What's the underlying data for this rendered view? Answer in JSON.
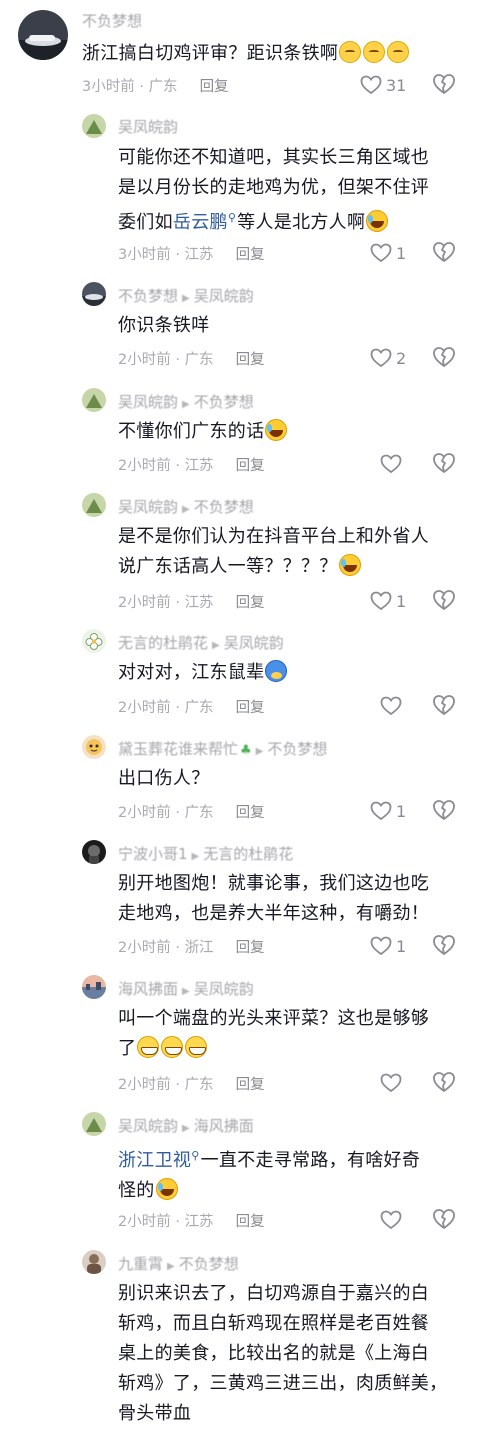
{
  "comments": [
    {
      "user": "不负梦想",
      "text_pre": "浙江搞白切鸡评审？距识条铁啊",
      "time": "3小时前",
      "location": "广东",
      "reply_label": "回复",
      "likes": "31"
    },
    {
      "user": "吴凤皖韵",
      "line1": "可能你还不知道吧，其实长三角区域也",
      "line2": "是以月份长的走地鸡为优，但架不住评",
      "line3_pre": "委们如",
      "topic": "岳云鹏",
      "line3_post": "等人是北方人啊",
      "time": "3小时前",
      "location": "江苏",
      "reply_label": "回复",
      "likes": "1"
    },
    {
      "user": "不负梦想",
      "reply_to": "吴凤皖韵",
      "text": "你识条铁咩",
      "time": "2小时前",
      "location": "广东",
      "reply_label": "回复",
      "likes": "2"
    },
    {
      "user": "吴凤皖韵",
      "reply_to": "不负梦想",
      "text": "不懂你们广东的话",
      "time": "2小时前",
      "location": "江苏",
      "reply_label": "回复",
      "likes": ""
    },
    {
      "user": "吴凤皖韵",
      "reply_to": "不负梦想",
      "line1": "是不是你们认为在抖音平台上和外省人",
      "line2": "说广东话高人一等？？？？",
      "time": "2小时前",
      "location": "江苏",
      "reply_label": "回复",
      "likes": "1"
    },
    {
      "user": "无言的杜鹃花",
      "reply_to": "吴凤皖韵",
      "text": "对对对，江东鼠辈",
      "time": "2小时前",
      "location": "广东",
      "reply_label": "回复",
      "likes": ""
    },
    {
      "user": "黛玉葬花谁来帮忙",
      "reply_to": "不负梦想",
      "text": "出口伤人？",
      "time": "2小时前",
      "location": "广东",
      "reply_label": "回复",
      "likes": "1"
    },
    {
      "user": "宁波小哥1",
      "reply_to": "无言的杜鹃花",
      "line1": "别开地图炮！就事论事，我们这边也吃",
      "line2": "走地鸡，也是养大半年这种，有嚼劲！",
      "time": "2小时前",
      "location": "浙江",
      "reply_label": "回复",
      "likes": "1"
    },
    {
      "user": "海风拂面",
      "reply_to": "吴凤皖韵",
      "line1": "叫一个端盘的光头来评菜？这也是够够",
      "line2": "了",
      "time": "2小时前",
      "location": "广东",
      "reply_label": "回复",
      "likes": ""
    },
    {
      "user": "吴凤皖韵",
      "reply_to": "海风拂面",
      "topic": "浙江卫视",
      "line1_post": "一直不走寻常路，有啥好奇",
      "line2": "怪的",
      "time": "2小时前",
      "location": "江苏",
      "reply_label": "回复",
      "likes": ""
    },
    {
      "user": "九重霄",
      "reply_to": "不负梦想",
      "line1": "别识来识去了，白切鸡源自于嘉兴的白",
      "line2": "斩鸡，而且白斩鸡现在照样是老百姓餐",
      "line3": "桌上的美食，比较出名的就是《上海白",
      "line4": "斩鸡》了，三黄鸡三进三出，肉质鲜美，",
      "line5": "骨头带血"
    }
  ],
  "colors": {
    "text": "#161823",
    "meta": "#a9aab0",
    "topic": "#2f5d9f",
    "icon": "#8a8b91"
  }
}
